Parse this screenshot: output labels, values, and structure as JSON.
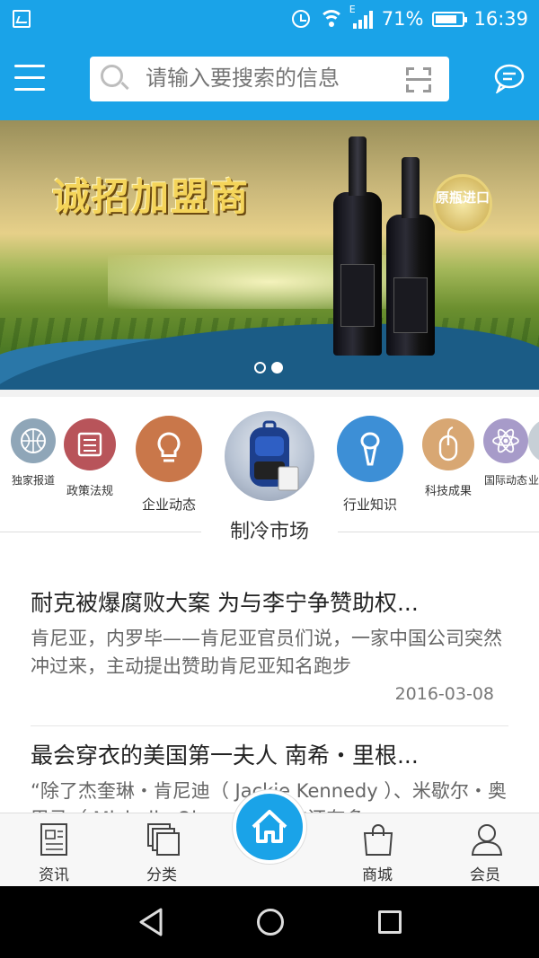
{
  "status_bar": {
    "battery": "71%",
    "time": "16:39",
    "network": "E"
  },
  "search": {
    "placeholder": "请输入要搜索的信息"
  },
  "banner": {
    "headline": "诚招加盟商",
    "badge": "原瓶进口",
    "page_count": 2,
    "active_page": 2
  },
  "categories": [
    {
      "label": "独家报道",
      "icon": "basketball-icon",
      "color": "#8fa6b8"
    },
    {
      "label": "政策法规",
      "icon": "newspaper-icon",
      "color": "#b8545a"
    },
    {
      "label": "企业动态",
      "icon": "lightbulb-icon",
      "color": "#c9774a"
    },
    {
      "label": "制冷市场",
      "icon": "backpack-photo",
      "color": "#2b3f6b"
    },
    {
      "label": "行业知识",
      "icon": "microphone-icon",
      "color": "#3d8fd6"
    },
    {
      "label": "科技成果",
      "icon": "mouse-icon",
      "color": "#d8a773"
    },
    {
      "label": "国际动态",
      "icon": "atom-icon",
      "color": "#a79bc9"
    },
    {
      "label": "业",
      "icon": "partial-icon",
      "color": "#c7cfd6"
    }
  ],
  "articles": [
    {
      "title": "耐克被爆腐败大案 为与李宁争赞助权...",
      "summary": "肯尼亚，内罗毕——肯尼亚官员们说，一家中国公司突然冲过来，主动提出赞助肯尼亚知名跑步",
      "date": "2016-03-08"
    },
    {
      "title": "最会穿衣的美国第一夫人 南希・里根...",
      "summary": "“除了杰奎琳・肯尼迪（ Jackie Kennedy ）、米歇尔・奥巴马（ Michelle Obama ）或许还有多"
    }
  ],
  "bottom_nav": [
    {
      "label": "资讯",
      "icon": "news-icon"
    },
    {
      "label": "分类",
      "icon": "layers-icon"
    },
    {
      "label": "",
      "icon": "home-icon"
    },
    {
      "label": "商城",
      "icon": "shopping-bag-icon"
    },
    {
      "label": "会员",
      "icon": "user-icon"
    }
  ],
  "colors": {
    "primary": "#1aa3e8",
    "banner_text": "#f4d45a"
  }
}
